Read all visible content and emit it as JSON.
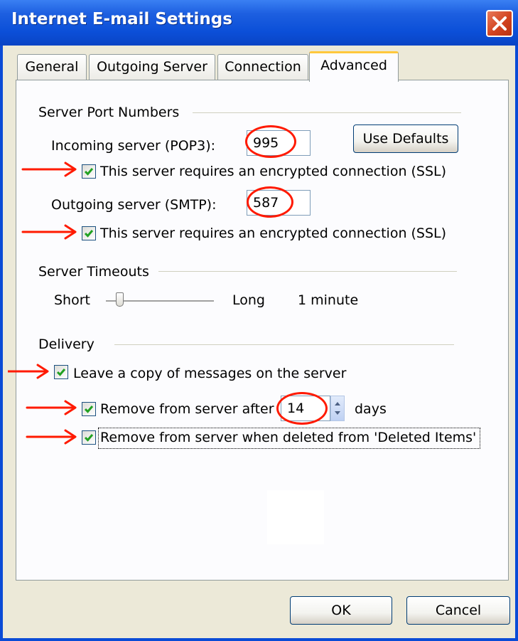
{
  "window": {
    "title": "Internet E-mail Settings"
  },
  "tabs": [
    {
      "label": "General",
      "active": false
    },
    {
      "label": "Outgoing Server",
      "active": false
    },
    {
      "label": "Connection",
      "active": false
    },
    {
      "label": "Advanced",
      "active": true
    }
  ],
  "server_ports": {
    "group_label": "Server Port Numbers",
    "incoming_label": "Incoming server (POP3):",
    "incoming_value": "995",
    "use_defaults_label": "Use Defaults",
    "incoming_ssl_label": "This server requires an encrypted connection (SSL)",
    "incoming_ssl_checked": true,
    "outgoing_label": "Outgoing server (SMTP):",
    "outgoing_value": "587",
    "outgoing_ssl_label": "This server requires an encrypted connection (SSL)",
    "outgoing_ssl_checked": true
  },
  "timeouts": {
    "group_label": "Server Timeouts",
    "short_label": "Short",
    "long_label": "Long",
    "value_label": "1 minute",
    "slider_fraction": 0.1
  },
  "delivery": {
    "group_label": "Delivery",
    "leave_copy_label": "Leave a copy of messages on the server",
    "leave_copy_checked": true,
    "remove_after_label": "Remove from server after",
    "remove_after_checked": true,
    "remove_after_days": "14",
    "days_label": "days",
    "remove_deleted_label": "Remove from server when deleted from 'Deleted Items'",
    "remove_deleted_checked": true
  },
  "footer": {
    "ok_label": "OK",
    "cancel_label": "Cancel"
  },
  "colors": {
    "title_bar": "#0a4bd6",
    "annotation_red": "#ff1a00",
    "check_green": "#21a121",
    "dialog_face": "#ece9d8"
  }
}
